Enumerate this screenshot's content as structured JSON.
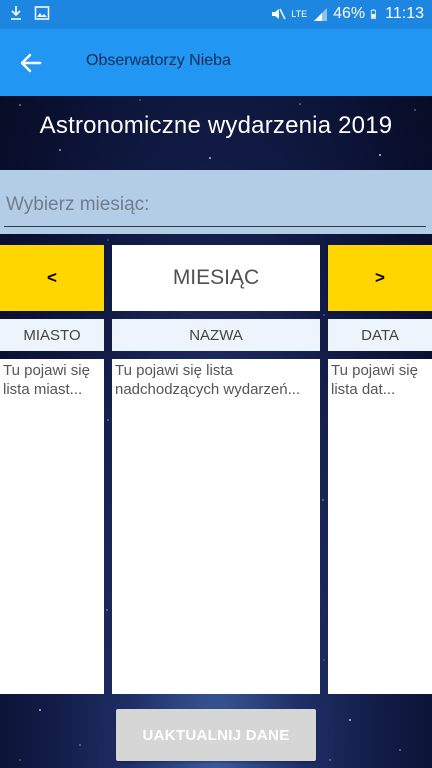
{
  "status_bar": {
    "battery": "46%",
    "time": "11:13",
    "network": "LTE",
    "icons": [
      "download-icon",
      "image-icon",
      "mute-vibrate-icon",
      "lte-icon",
      "signal-icon",
      "battery-icon"
    ]
  },
  "app_bar": {
    "title": "Obserwatorzy Nieba",
    "back_icon": "arrow-back-icon"
  },
  "header": {
    "title": "Astronomiczne wydarzenia 2019"
  },
  "month_select": {
    "label": "Wybierz miesiąc:"
  },
  "nav": {
    "prev_label": "<",
    "month_label": "MIESIĄC",
    "next_label": ">"
  },
  "columns": {
    "city": "MIASTO",
    "name": "NAZWA",
    "date": "DATA"
  },
  "lists": {
    "city_placeholder": "Tu pojawi się lista miast...",
    "name_placeholder": "Tu pojawi się lista nadchodzących wydarzeń...",
    "date_placeholder": "Tu pojawi się lista dat..."
  },
  "actions": {
    "update_label": "UAKTUALNIJ DANE"
  },
  "colors": {
    "status_bar": "#1c86e0",
    "app_bar": "#2196f3",
    "nav_button": "#ffd600",
    "month_field": "#b4cde6",
    "update_button": "#d6d6d6"
  }
}
